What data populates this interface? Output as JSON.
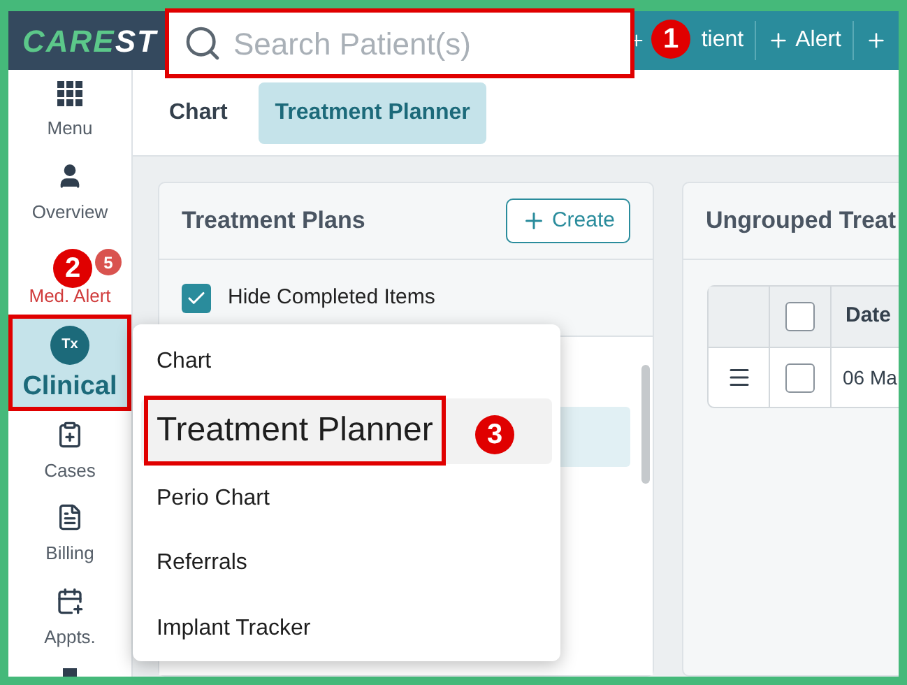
{
  "logo": {
    "accent": "CARE",
    "rest": "ST"
  },
  "search": {
    "placeholder": "Search Patient(s)",
    "annotation": "1"
  },
  "top_actions": [
    {
      "label": "tient"
    },
    {
      "label": "Alert"
    }
  ],
  "sidebar": {
    "items": [
      {
        "label": "Menu",
        "selected": false,
        "alert": false
      },
      {
        "label": "Overview",
        "selected": false,
        "alert": false
      },
      {
        "label": "Med. Alert",
        "selected": false,
        "alert": true,
        "count": "5",
        "annotation": "2"
      },
      {
        "label": "Clinical",
        "selected": true,
        "alert": false,
        "icon_text": "Tx"
      },
      {
        "label": "Cases",
        "selected": false,
        "alert": false
      },
      {
        "label": "Billing",
        "selected": false,
        "alert": false
      },
      {
        "label": "Appts.",
        "selected": false,
        "alert": false
      }
    ]
  },
  "tabs": [
    {
      "label": "Chart",
      "selected": false
    },
    {
      "label": "Treatment Planner",
      "selected": true
    }
  ],
  "treatment_plans": {
    "title": "Treatment Plans",
    "create_button": "Create",
    "hide_completed": {
      "label": "Hide Completed Items",
      "checked": true
    }
  },
  "ungrouped": {
    "title": "Ungrouped Treat",
    "columns": [
      "Date"
    ],
    "header_checked": false,
    "rows": [
      {
        "checked": false,
        "date": "06 Ma"
      }
    ]
  },
  "menu": {
    "items": [
      {
        "label": "Chart",
        "highlighted": false
      },
      {
        "label": "Treatment Planner",
        "highlighted": true,
        "annotation": "3"
      },
      {
        "label": "Perio Chart",
        "highlighted": false
      },
      {
        "label": "Referrals",
        "highlighted": false
      },
      {
        "label": "Implant Tracker",
        "highlighted": false
      }
    ]
  }
}
